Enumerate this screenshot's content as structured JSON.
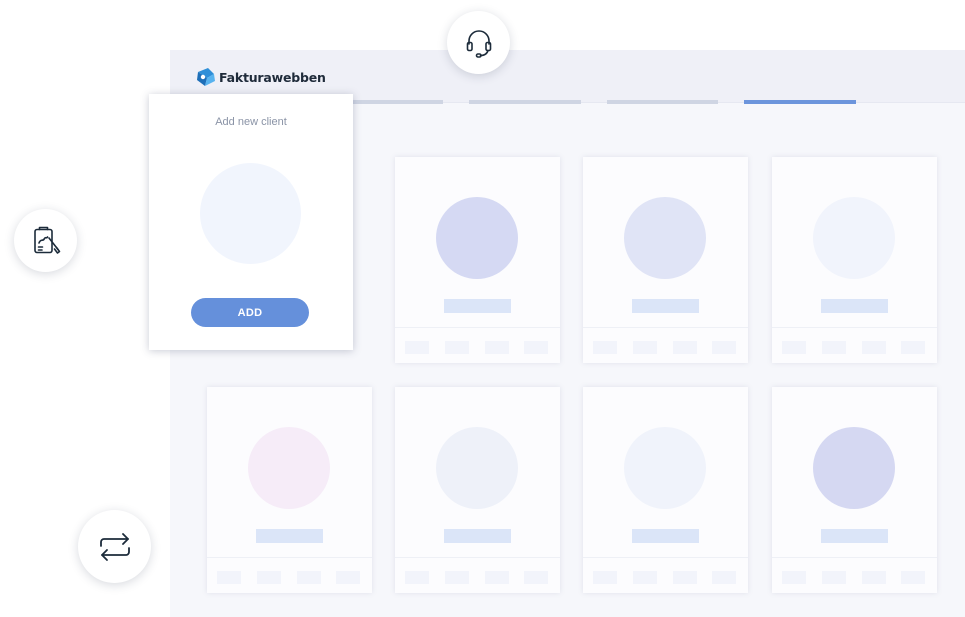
{
  "brand": {
    "name": "Fakturawebben"
  },
  "add_client_panel": {
    "title": "Add new client",
    "add_label": "ADD"
  },
  "nav_tabs": [
    {
      "id": "tab-1",
      "active": false
    },
    {
      "id": "tab-2",
      "active": false
    },
    {
      "id": "tab-3",
      "active": false
    },
    {
      "id": "tab-4",
      "active": true
    }
  ],
  "client_cards": [
    {
      "avatar_color": "#d5d9f3"
    },
    {
      "avatar_color": "#e0e4f6"
    },
    {
      "avatar_color": "#f1f4fc"
    },
    {
      "avatar_color": "#f6ecf8"
    },
    {
      "avatar_color": "#eef1f9"
    },
    {
      "avatar_color": "#f0f3fb"
    },
    {
      "avatar_color": "#d5d8f2"
    }
  ],
  "icons": {
    "support": "headset-icon",
    "invoice": "signed-document-icon",
    "sync": "swap-arrows-icon"
  },
  "colors": {
    "accent": "#6590db",
    "active_tab": "#6c95dc",
    "icon_stroke": "#1c2b3a",
    "logo_blue": "#2f8fd8"
  }
}
